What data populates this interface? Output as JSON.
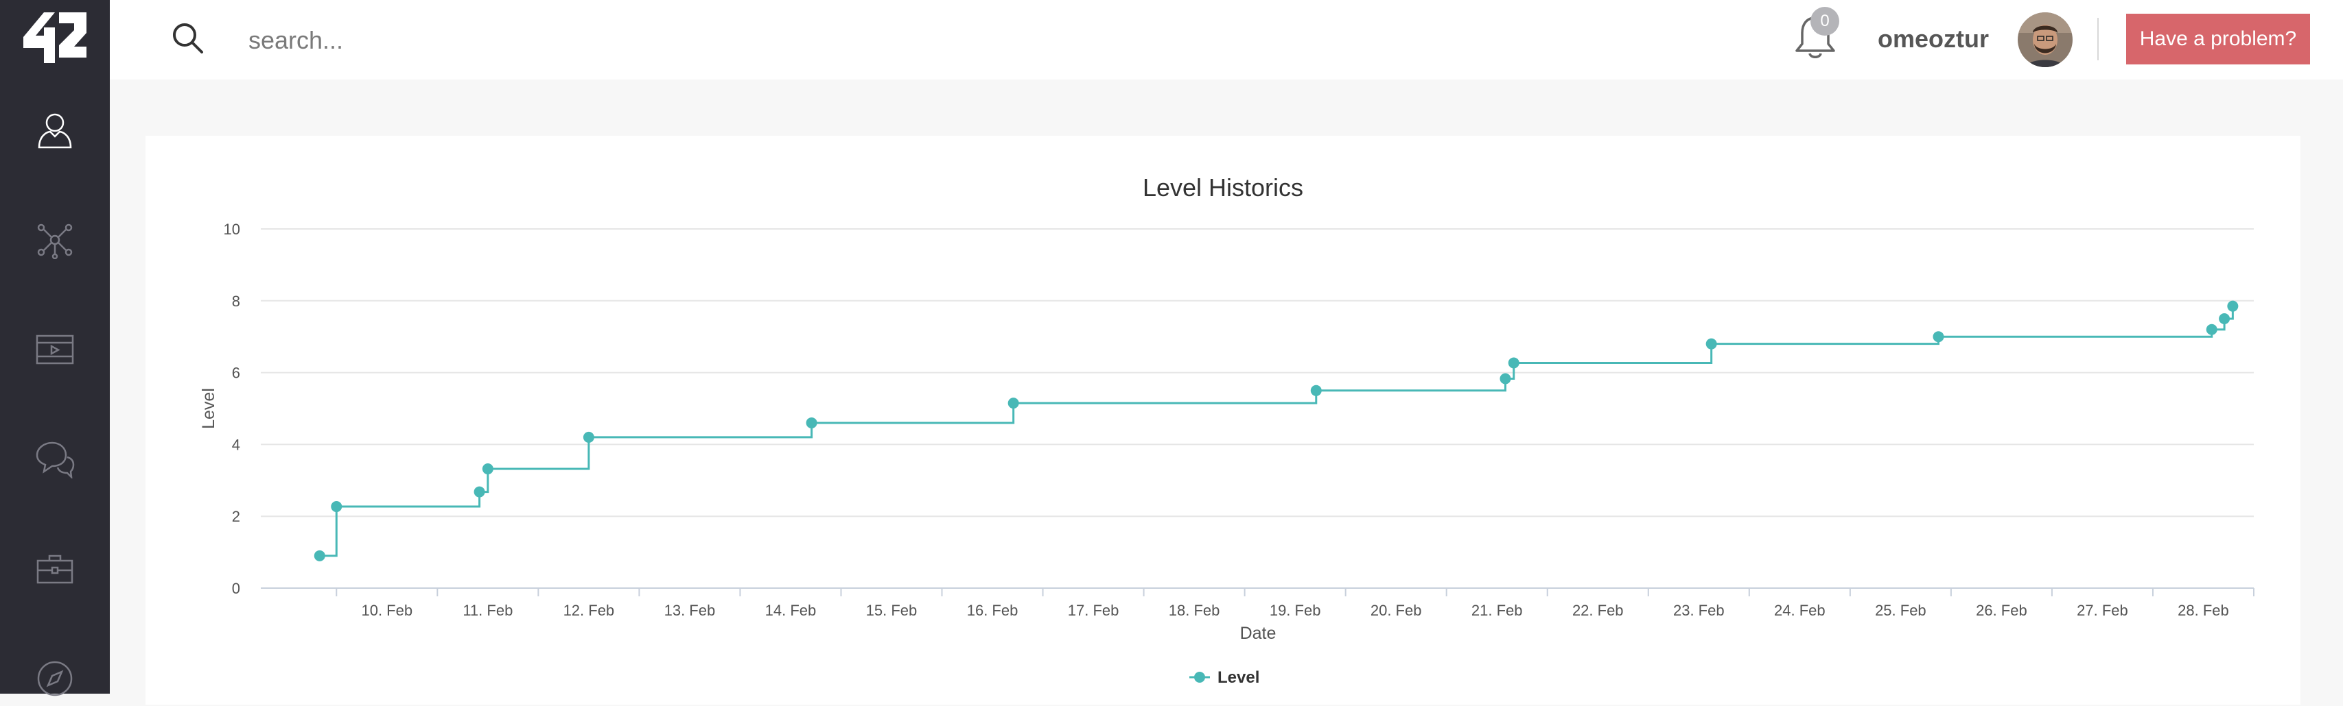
{
  "sidebar": {
    "logo_text": "42",
    "items": [
      {
        "icon": "user-icon"
      },
      {
        "icon": "network-icon"
      },
      {
        "icon": "video-icon"
      },
      {
        "icon": "chat-icon"
      },
      {
        "icon": "briefcase-icon"
      },
      {
        "icon": "compass-icon"
      }
    ]
  },
  "header": {
    "search_placeholder": "search...",
    "notification_count": "0",
    "username": "omeoztur",
    "problem_button": "Have a problem?"
  },
  "colors": {
    "sidebar_bg": "#2c2c34",
    "accent_teal": "#48b8b6",
    "problem_button_bg": "#d7666b"
  },
  "chart_data": {
    "type": "line",
    "step": true,
    "title": "Level Historics",
    "xlabel": "Date",
    "ylabel": "Level",
    "ylim": [
      0,
      10
    ],
    "yticks": [
      0,
      2,
      4,
      6,
      8,
      10
    ],
    "xlim": [
      "9 Feb 06:00",
      "29 Feb 00:00"
    ],
    "xticks": [
      "10. Feb",
      "11. Feb",
      "12. Feb",
      "13. Feb",
      "14. Feb",
      "15. Feb",
      "16. Feb",
      "17. Feb",
      "18. Feb",
      "19. Feb",
      "20. Feb",
      "21. Feb",
      "22. Feb",
      "23. Feb",
      "24. Feb",
      "25. Feb",
      "26. Feb",
      "27. Feb",
      "28. Feb"
    ],
    "grid": true,
    "legend": "bottom-center",
    "series": [
      {
        "name": "Level",
        "color": "#48b8b6",
        "points": [
          [
            "9 Feb 20:00",
            0.9
          ],
          [
            "10 Feb 00:00",
            2.27
          ],
          [
            "11 Feb 10:00",
            2.68
          ],
          [
            "11 Feb 12:00",
            3.32
          ],
          [
            "12 Feb 12:00",
            4.2
          ],
          [
            "14 Feb 17:00",
            4.6
          ],
          [
            "16 Feb 17:00",
            5.15
          ],
          [
            "19 Feb 17:00",
            5.5
          ],
          [
            "21 Feb 14:00",
            5.83
          ],
          [
            "21 Feb 16:00",
            6.27
          ],
          [
            "23 Feb 15:00",
            6.8
          ],
          [
            "25 Feb 21:00",
            7.0
          ],
          [
            "28 Feb 14:00",
            7.2
          ],
          [
            "28 Feb 17:00",
            7.5
          ],
          [
            "28 Feb 19:00",
            7.85
          ]
        ]
      }
    ]
  }
}
